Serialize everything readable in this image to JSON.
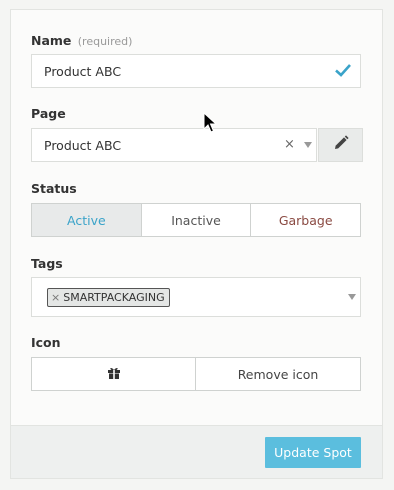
{
  "name": {
    "label": "Name",
    "hint": "(required)",
    "value": "Product ABC",
    "valid_icon": "checkmark-icon"
  },
  "page": {
    "label": "Page",
    "selected": "Product ABC",
    "clear_glyph": "×",
    "edit_icon": "pencil-icon"
  },
  "status": {
    "label": "Status",
    "options": [
      "Active",
      "Inactive",
      "Garbage"
    ],
    "selected": "Active"
  },
  "tags": {
    "label": "Tags",
    "items": [
      {
        "remove_glyph": "×",
        "text": "SMARTPACKAGING"
      }
    ]
  },
  "icon": {
    "label": "Icon",
    "current_icon": "gift-icon",
    "remove_label": "Remove icon"
  },
  "footer": {
    "update_label": "Update Spot"
  },
  "colors": {
    "accent": "#3aa3c9",
    "button": "#5bbede",
    "garbage": "#8a4a42"
  }
}
